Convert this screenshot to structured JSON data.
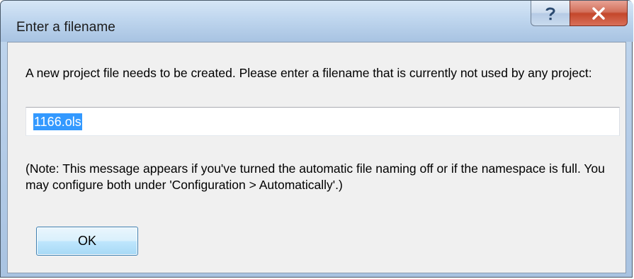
{
  "window": {
    "title": "Enter a filename"
  },
  "title_buttons": {
    "help_icon": "question-mark-icon",
    "close_icon": "x-icon"
  },
  "dialog": {
    "prompt": "A new project file needs to be created. Please enter a filename that is currently not used by any project:",
    "filename_value": "1166.ols",
    "note": "(Note: This message appears if you've turned the automatic file naming off or if the namespace is full. You may configure both under 'Configuration > Automatically'.)",
    "ok_label": "OK"
  },
  "colors": {
    "selection": "#3399ff",
    "close_button": "#c4472b",
    "dialog_background": "#f0f0f0"
  }
}
